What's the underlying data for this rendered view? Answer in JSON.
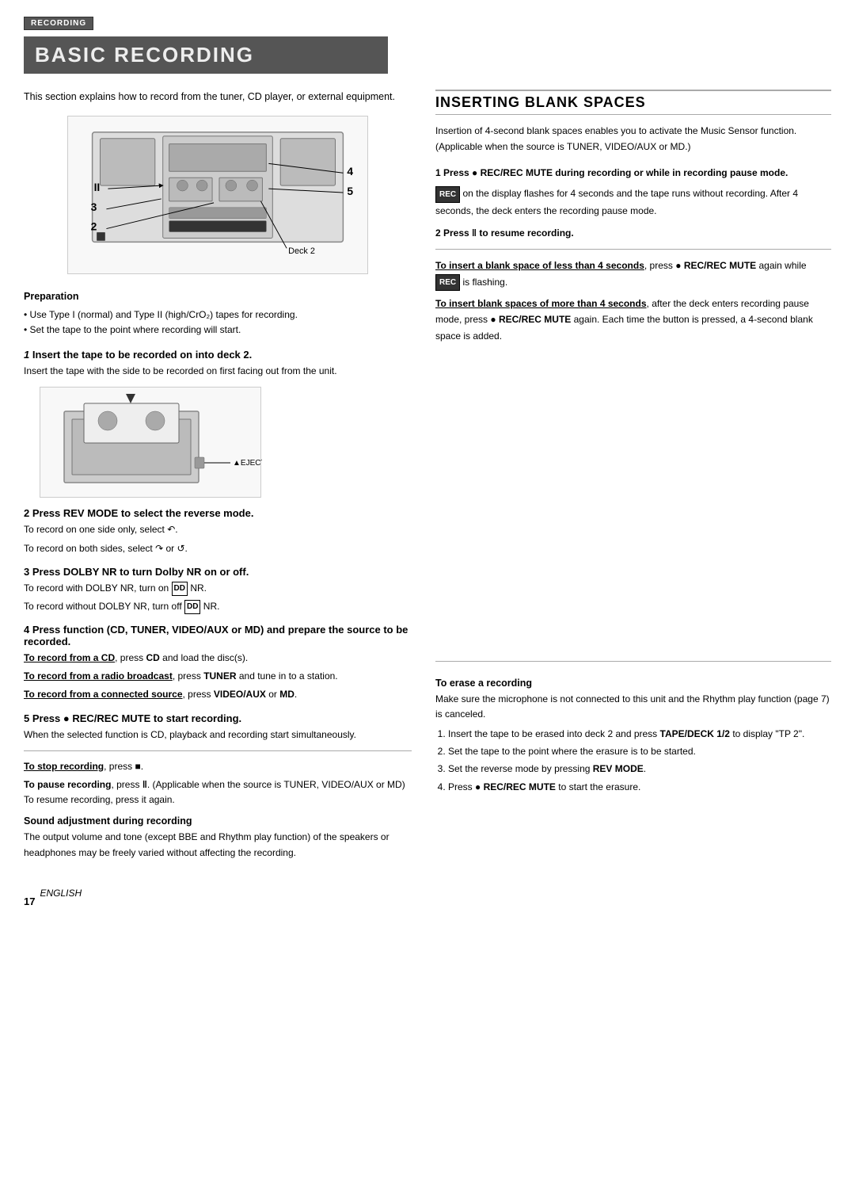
{
  "recording_badge": "RECORDING",
  "main_title": "BASIC RECORDING",
  "left_col": {
    "intro": "This section explains how to record from the tuner, CD player, or external equipment.",
    "preparation": {
      "title": "Preparation",
      "bullets": [
        "Use Type I (normal) and Type II (high/CrO₂) tapes for recording.",
        "Set the tape to the point where recording will start."
      ]
    },
    "steps": [
      {
        "num": "1",
        "heading": "Insert the tape to be recorded on into deck 2.",
        "body": "Insert the tape with the side to be recorded on first facing out from the unit."
      },
      {
        "num": "2",
        "heading": "Press REV MODE to select the reverse mode.",
        "lines": [
          "To record on one side only, select ↶.",
          "To record on both sides, select ↷ or ↺."
        ]
      },
      {
        "num": "3",
        "heading": "Press DOLBY NR to turn Dolby NR on or off.",
        "lines": [
          "To record with DOLBY NR, turn on □□ NR.",
          "To record without DOLBY NR, turn off □□ NR."
        ]
      },
      {
        "num": "4",
        "heading": "Press function (CD, TUNER, VIDEO/AUX or MD) and prepare the source to be recorded.",
        "lines": [
          "To record from a CD, press CD and load the disc(s).",
          "To record from a radio broadcast, press TUNER and tune in to a station.",
          "To record from a connected source, press VIDEO/AUX or MD."
        ]
      },
      {
        "num": "5",
        "heading": "Press ● REC/REC MUTE to start recording.",
        "body": "When the selected function is CD, playback and recording start simultaneously."
      }
    ],
    "stop_recording": {
      "label": "To stop recording",
      "text": ", press ■."
    },
    "pause_recording": {
      "label": "To pause recording",
      "text": ", press ‖. (Applicable when the source is TUNER, VIDEO/AUX or MD) To resume recording, press it again."
    },
    "sound_adjustment": {
      "title": "Sound adjustment during recording",
      "body": "The output volume and tone (except BBE and Rhythm play function) of the speakers or headphones may be freely varied without affecting the recording."
    }
  },
  "right_col": {
    "section_title": "INSERTING BLANK SPACES",
    "intro": "Insertion of 4-second blank spaces enables you to activate the Music Sensor function. (Applicable when the source is TUNER, VIDEO/AUX or MD.)",
    "steps": [
      {
        "num": "1",
        "heading": "Press ● REC/REC MUTE during recording or while in recording pause mode.",
        "body": "REC on the display flashes for 4 seconds and the tape runs without recording. After 4 seconds, the deck enters the recording pause mode."
      },
      {
        "num": "2",
        "heading": "Press ‖ to resume recording."
      }
    ],
    "less_than_note_label": "To insert a blank space of less than 4 seconds",
    "less_than_note": ", press ● REC/REC MUTE again while REC is flashing.",
    "more_than_note_label": "To insert blank spaces of more than 4 seconds",
    "more_than_note": ", after the deck enters recording pause mode, press ● REC/REC MUTE again. Each time the button is pressed, a 4-second blank space is added.",
    "erase": {
      "title": "To erase a recording",
      "intro": "Make sure the microphone is not connected to this unit and the Rhythm play function (page 7) is canceled.",
      "steps": [
        "Insert the tape to be erased into deck 2 and press TAPE/DECK 1/2 to display \"TP 2\".",
        "Set the tape to the point where the erasure is to be started.",
        "Set the reverse mode by pressing REV MODE.",
        "Press ● REC/REC MUTE to start the erasure."
      ]
    }
  },
  "page_number": "17",
  "english_label": "ENGLISH"
}
